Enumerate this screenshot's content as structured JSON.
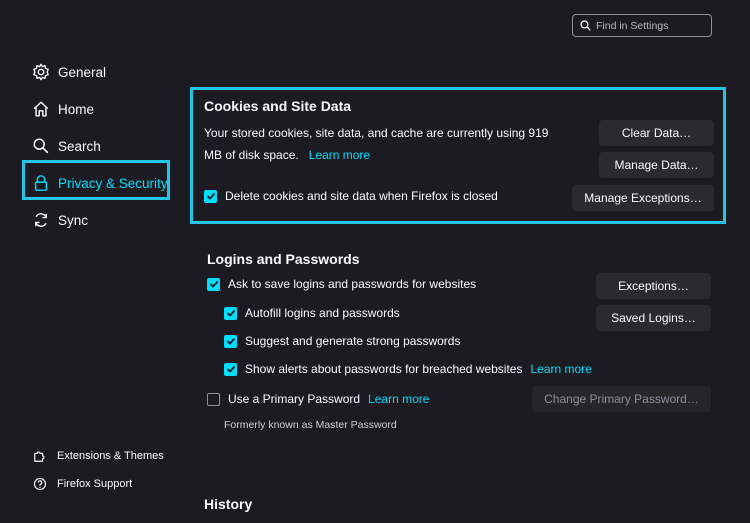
{
  "search": {
    "placeholder": "Find in Settings"
  },
  "sidebar": {
    "items": [
      {
        "label": "General"
      },
      {
        "label": "Home"
      },
      {
        "label": "Search"
      },
      {
        "label": "Privacy & Security",
        "selected": true
      },
      {
        "label": "Sync"
      }
    ],
    "footer": [
      {
        "label": "Extensions & Themes"
      },
      {
        "label": "Firefox Support"
      }
    ]
  },
  "cookies": {
    "title": "Cookies and Site Data",
    "description_line1": "Your stored cookies, site data, and cache are currently using 919",
    "description_line2": "MB of disk space.",
    "learn_more": "Learn more",
    "delete_on_close_label": "Delete cookies and site data when Firefox is closed",
    "delete_on_close_checked": true,
    "clear_data_button": "Clear Data…",
    "manage_data_button": "Manage Data…",
    "manage_exceptions_button": "Manage Exceptions…"
  },
  "logins": {
    "title": "Logins and Passwords",
    "ask_to_save_label": "Ask to save logins and passwords for websites",
    "autofill_label": "Autofill logins and passwords",
    "suggest_label": "Suggest and generate strong passwords",
    "alerts_label": "Show alerts about passwords for breached websites",
    "alerts_learn_more": "Learn more",
    "primary_password_label": "Use a Primary Password",
    "primary_learn_more": "Learn more",
    "formerly_known": "Formerly known as Master Password",
    "exceptions_button": "Exceptions…",
    "saved_logins_button": "Saved Logins…",
    "change_primary_button": "Change Primary Password…"
  },
  "history": {
    "title": "History"
  },
  "colors": {
    "accent": "#00ddff",
    "highlight_frame": "#22c7e5",
    "background": "#1c1b22",
    "button": "#2b2a33"
  }
}
